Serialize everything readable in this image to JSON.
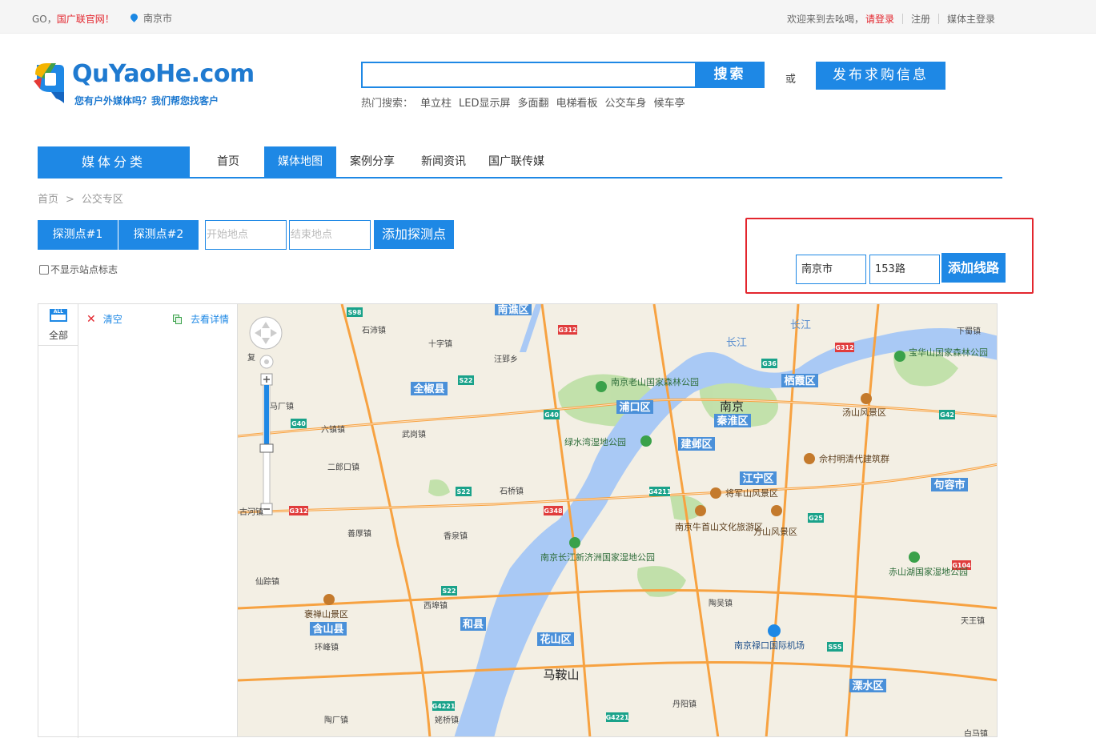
{
  "topbar": {
    "go_prefix": "GO，",
    "go_link": "国广联官网！",
    "city": "南京市",
    "welcome": "欢迎来到去吆喝，",
    "login": "请登录",
    "register": "注册",
    "media_login": "媒体主登录"
  },
  "logo": {
    "title": "QuYaoHe.com",
    "slogan": "您有户外媒体吗？我们帮您找客户"
  },
  "search": {
    "value": "",
    "button": "搜索",
    "or": "或",
    "publish": "发布求购信息",
    "hot_label": "热门搜索：",
    "hot_items": [
      "单立柱",
      "LED显示屏",
      "多面翻",
      "电梯看板",
      "公交车身",
      "候车亭"
    ]
  },
  "nav": {
    "category": "媒体分类",
    "items": [
      "首页",
      "媒体地图",
      "案例分享",
      "新闻资讯",
      "国广联传媒"
    ],
    "active": "媒体地图"
  },
  "breadcrumb": {
    "home": "首页",
    "arrow": ">",
    "current": "公交专区"
  },
  "probe": {
    "btn1": "探测点#1",
    "btn2": "探测点#2",
    "start_placeholder": "开始地点",
    "end_placeholder": "结束地点",
    "add": "添加探测点",
    "hide_stops": "不显示站点标志"
  },
  "route": {
    "city": "南京市",
    "line": "153路",
    "add": "添加线路"
  },
  "sidebar": {
    "all_icon_text": "ALL",
    "all": "全部",
    "clear": "清空",
    "detail": "去看详情"
  },
  "map": {
    "colors": {
      "land": "#f3efe4",
      "water": "#a9c9f5",
      "green": "#b9dea1",
      "road": "#f7a241",
      "highway_badge": "#1aa28a",
      "national_badge": "#e03c3c",
      "district_badge": "#4a90d9"
    },
    "districts": [
      "南谯区",
      "全椒县",
      "浦口区",
      "秦淮区",
      "建邺区",
      "栖霞区",
      "江宁区",
      "句容市",
      "和县",
      "花山区",
      "含山县",
      "溧水区"
    ],
    "cities": [
      "南京",
      "马鞍山"
    ],
    "towns": [
      "石沛镇",
      "十字镇",
      "汪郢乡",
      "复",
      "马厂镇",
      "六镇镇",
      "武岗镇",
      "二郎口镇",
      "石桥镇",
      "古河镇",
      "善厚镇",
      "香泉镇",
      "仙踪镇",
      "西埠镇",
      "环峰镇",
      "陶厂镇",
      "姥桥镇",
      "丹阳镇",
      "白马镇",
      "天王镇",
      "陶吴镇",
      "下蜀镇",
      "长江",
      "长江"
    ],
    "pois": [
      "南京老山国家森林公园",
      "绿水湾湿地公园",
      "宝华山国家森林公园",
      "汤山风景区",
      "佘村明清代建筑群",
      "将军山风景区",
      "方山风景区",
      "南京牛首山文化旅游区",
      "南京长江新济洲国家湿地公园",
      "赤山湖国家湿地公园",
      "褒禅山景区",
      "南京禄口国际机场"
    ],
    "road_badges": [
      "S98",
      "G312",
      "G312",
      "S22",
      "G40",
      "G36",
      "G42",
      "G40",
      "S22",
      "G4211",
      "G348",
      "G312",
      "G25",
      "S22",
      "G104",
      "S55",
      "G4221",
      "G4221"
    ]
  }
}
